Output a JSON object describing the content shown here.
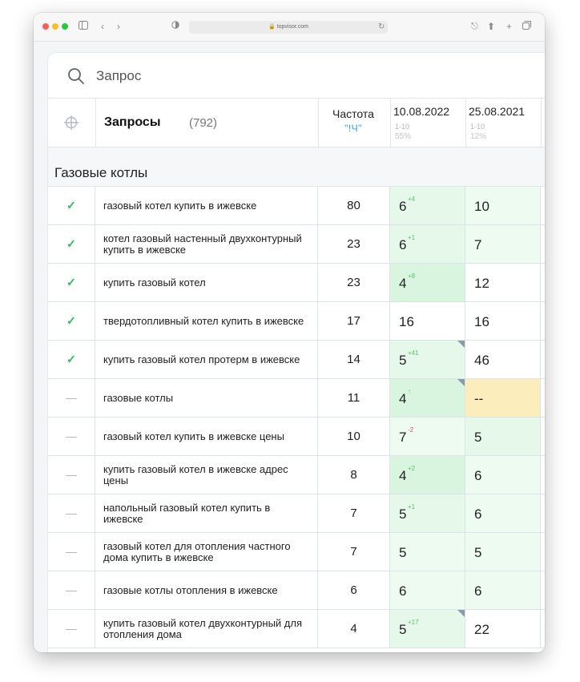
{
  "browser": {
    "url": "topvisor.com"
  },
  "search": {
    "placeholder": "Запрос"
  },
  "table": {
    "header": {
      "title": "Запросы",
      "count": "(792)",
      "freq_title": "Частота",
      "freq_sub": "\"!Ч\"",
      "dates": [
        {
          "date": "10.08.2022",
          "range": "1-10",
          "percent": "55%"
        },
        {
          "date": "25.08.2021",
          "range": "1-10",
          "percent": "12%"
        }
      ]
    },
    "group": "Газовые котлы",
    "rows": [
      {
        "status": "check",
        "query": "газовый котел купить в ижевске",
        "freq": "80",
        "pos1": "6",
        "delta": "+4",
        "dir": "up",
        "pos2": "10",
        "bg1": "g2",
        "bg2": "g3",
        "flag": false
      },
      {
        "status": "check",
        "query": "котел газовый настенный двухконтурный купить в ижевске",
        "freq": "23",
        "pos1": "6",
        "delta": "+1",
        "dir": "up",
        "pos2": "7",
        "bg1": "g2",
        "bg2": "g3",
        "flag": false
      },
      {
        "status": "check",
        "query": "купить газовый котел",
        "freq": "23",
        "pos1": "4",
        "delta": "+8",
        "dir": "up",
        "pos2": "12",
        "bg1": "g1",
        "bg2": "wh",
        "flag": false
      },
      {
        "status": "check",
        "query": "твердотопливный котел купить в ижевске",
        "freq": "17",
        "pos1": "16",
        "delta": "",
        "dir": "",
        "pos2": "16",
        "bg1": "wh",
        "bg2": "wh",
        "flag": false
      },
      {
        "status": "check",
        "query": "купить газовый котел протерм в ижевске",
        "freq": "14",
        "pos1": "5",
        "delta": "+41",
        "dir": "up",
        "pos2": "46",
        "bg1": "g2",
        "bg2": "wh",
        "flag": true
      },
      {
        "status": "dash",
        "query": "газовые котлы",
        "freq": "11",
        "pos1": "4",
        "delta": "↑",
        "dir": "up",
        "pos2": "--",
        "bg1": "g1",
        "bg2": "yel",
        "flag": true
      },
      {
        "status": "dash",
        "query": "газовый котел купить в ижевске цены",
        "freq": "10",
        "pos1": "7",
        "delta": "-2",
        "dir": "down",
        "pos2": "5",
        "bg1": "g3",
        "bg2": "g2",
        "flag": false
      },
      {
        "status": "dash",
        "query": "купить газовый котел в ижевске адрес цены",
        "freq": "8",
        "pos1": "4",
        "delta": "+2",
        "dir": "up",
        "pos2": "6",
        "bg1": "g1",
        "bg2": "g3",
        "flag": false
      },
      {
        "status": "dash",
        "query": "напольный газовый котел купить в ижевске",
        "freq": "7",
        "pos1": "5",
        "delta": "+1",
        "dir": "up",
        "pos2": "6",
        "bg1": "g2",
        "bg2": "g3",
        "flag": false
      },
      {
        "status": "dash",
        "query": "газовый котел для отопления частного дома купить в ижевске",
        "freq": "7",
        "pos1": "5",
        "delta": "",
        "dir": "",
        "pos2": "5",
        "bg1": "g3",
        "bg2": "g3",
        "flag": false
      },
      {
        "status": "dash",
        "query": "газовые котлы отопления в ижевске",
        "freq": "6",
        "pos1": "6",
        "delta": "",
        "dir": "",
        "pos2": "6",
        "bg1": "g3",
        "bg2": "g3",
        "flag": false
      },
      {
        "status": "dash",
        "query": "купить газовый котел двухконтурный для отопления дома",
        "freq": "4",
        "pos1": "5",
        "delta": "+17",
        "dir": "up",
        "pos2": "22",
        "bg1": "g2",
        "bg2": "wh",
        "flag": true
      }
    ]
  },
  "colors": {
    "check": "#2eb85c",
    "delta_up": "#55c26c",
    "delta_down": "#e0535b",
    "freq_accent": "#3a9ee6"
  }
}
